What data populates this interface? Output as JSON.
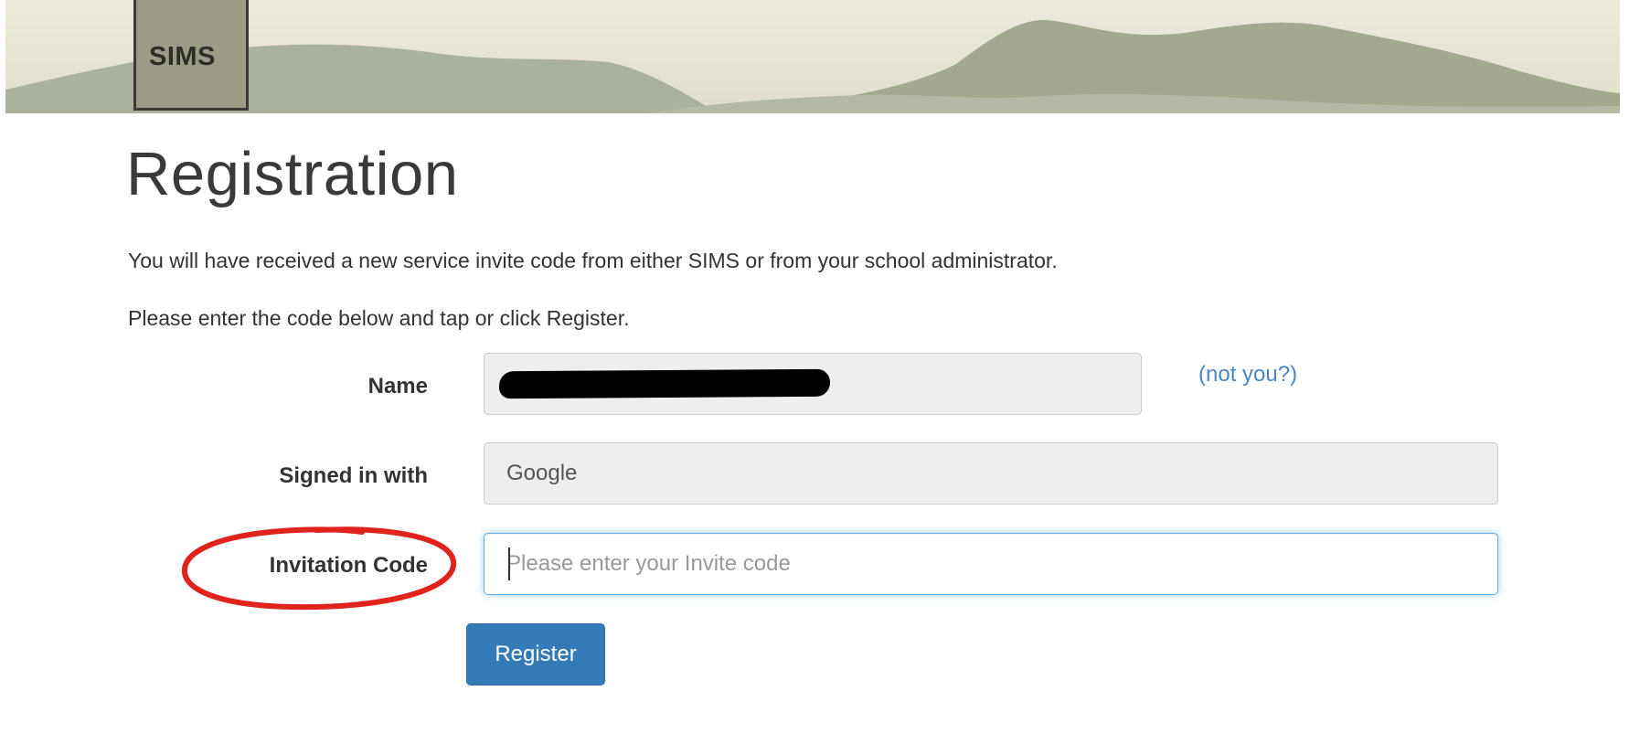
{
  "header": {
    "logo_text": "SIMS"
  },
  "page": {
    "title": "Registration",
    "intro_line_1": "You will have received a new service invite code from either SIMS or from your school administrator.",
    "intro_line_2": "Please enter the code below and tap or click Register."
  },
  "form": {
    "name_label": "Name",
    "name_value_redacted": true,
    "not_you_link": "(not you?)",
    "signed_in_label": "Signed in with",
    "signed_in_value": "Google",
    "invite_label": "Invitation Code",
    "invite_value": "",
    "invite_placeholder": "Please enter your Invite code",
    "register_label": "Register"
  },
  "colors": {
    "link": "#4a86c5",
    "button": "#337ab7",
    "annotation": "#e0231c",
    "banner_sky": "#e3e2cf",
    "banner_hills": "#9ea58e"
  }
}
